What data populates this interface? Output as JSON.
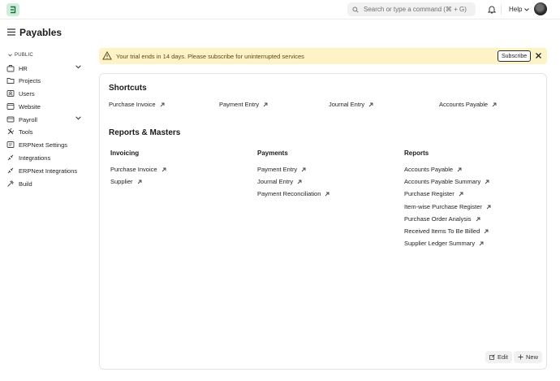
{
  "navbar": {
    "search_placeholder": "Search or type a command (⌘ + G)",
    "help_label": "Help"
  },
  "page": {
    "title": "Payables"
  },
  "sidebar": {
    "section_label": "PUBLIC",
    "items": [
      {
        "label": "HR",
        "icon": "hr-icon",
        "expandable": true
      },
      {
        "label": "Projects",
        "icon": "folder-icon",
        "expandable": false
      },
      {
        "label": "Users",
        "icon": "users-icon",
        "expandable": false
      },
      {
        "label": "Website",
        "icon": "website-icon",
        "expandable": false
      },
      {
        "label": "Payroll",
        "icon": "payroll-icon",
        "expandable": true
      },
      {
        "label": "Tools",
        "icon": "tools-icon",
        "expandable": false
      },
      {
        "label": "ERPNext Settings",
        "icon": "settings-icon",
        "expandable": false
      },
      {
        "label": "Integrations",
        "icon": "integrations-icon",
        "expandable": false
      },
      {
        "label": "ERPNext Integrations",
        "icon": "integrations-icon",
        "expandable": false
      },
      {
        "label": "Build",
        "icon": "build-icon",
        "expandable": false
      }
    ]
  },
  "banner": {
    "message": "Your trial ends in 14 days. Please subscribe for uninterrupted services",
    "subscribe_label": "Subscribe"
  },
  "shortcuts": {
    "title": "Shortcuts",
    "items": [
      "Purchase Invoice",
      "Payment Entry",
      "Journal Entry",
      "Accounts Payable"
    ]
  },
  "reports_masters": {
    "title": "Reports & Masters",
    "columns": [
      {
        "title": "Invoicing",
        "links": [
          "Purchase Invoice",
          "Supplier"
        ]
      },
      {
        "title": "Payments",
        "links": [
          "Payment Entry",
          "Journal Entry",
          "Payment Reconciliation"
        ]
      },
      {
        "title": "Reports",
        "links": [
          "Accounts Payable",
          "Accounts Payable Summary",
          "Purchase Register",
          "Item-wise Purchase Register",
          "Purchase Order Analysis",
          "Received Items To Be Billed",
          "Supplier Ledger Summary"
        ]
      }
    ]
  },
  "actions": {
    "edit_label": "Edit",
    "new_label": "New"
  },
  "colors": {
    "banner_bg": "#fdf3c7",
    "logo_bg": "#cdeeda",
    "accent": "#1a1a1a"
  }
}
